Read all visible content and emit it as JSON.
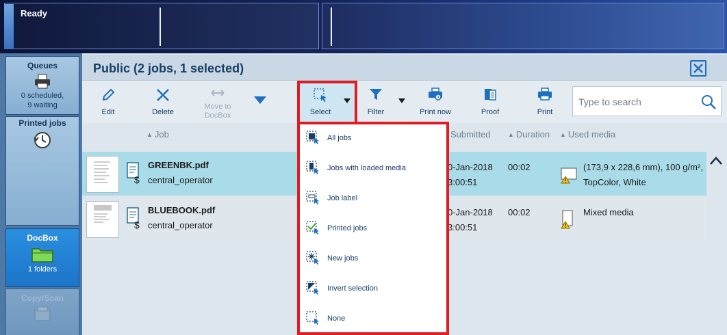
{
  "status": {
    "text": "Ready"
  },
  "nav": {
    "queues": {
      "title": "Queues",
      "line1": "0 scheduled,",
      "line2": "9 waiting"
    },
    "printed": {
      "title": "Printed jobs"
    },
    "docbox": {
      "title": "DocBox",
      "sub": "1 folders"
    },
    "copy": {
      "title": "Copy/Scan"
    }
  },
  "header": {
    "title": "Public (2 jobs, 1 selected)"
  },
  "toolbar": {
    "edit": "Edit",
    "delete": "Delete",
    "move_line1": "Move to",
    "move_line2": "DocBox",
    "select": "Select",
    "filter": "Filter",
    "print_now": "Print now",
    "proof": "Proof",
    "print": "Print"
  },
  "search": {
    "placeholder": "Type to search"
  },
  "columns": {
    "job": "Job",
    "submitted": "Submitted",
    "duration": "Duration",
    "media": "Used media"
  },
  "rows": [
    {
      "name": "GREENBK.pdf",
      "owner": "central_operator",
      "date": "0-Jan-2018",
      "time": "3:00:51",
      "duration": "00:02",
      "media_line1": "(173,9 x 228,6 mm), 100 g/m²,",
      "media_line2": "TopColor, White",
      "selected": true
    },
    {
      "name": "BLUEBOOK.pdf",
      "owner": "central_operator",
      "date": "0-Jan-2018",
      "time": "3:00:51",
      "duration": "00:02",
      "media_line1": "Mixed media",
      "media_line2": "",
      "selected": false
    }
  ],
  "select_menu": [
    {
      "label": "All jobs",
      "icon": "select-all-icon"
    },
    {
      "label": "Jobs with loaded media",
      "icon": "select-loaded-media-icon"
    },
    {
      "label": "Job label",
      "icon": "select-job-label-icon"
    },
    {
      "label": "Printed jobs",
      "icon": "select-printed-icon"
    },
    {
      "label": "New jobs",
      "icon": "select-new-icon"
    },
    {
      "label": "Invert selection",
      "icon": "invert-selection-icon"
    },
    {
      "label": "None",
      "icon": "select-none-icon"
    }
  ],
  "colors": {
    "accent": "#1d6fc2",
    "selected_row": "#aadbe8",
    "highlight": "#e01b22",
    "nav_active": "#2b8fe0"
  }
}
